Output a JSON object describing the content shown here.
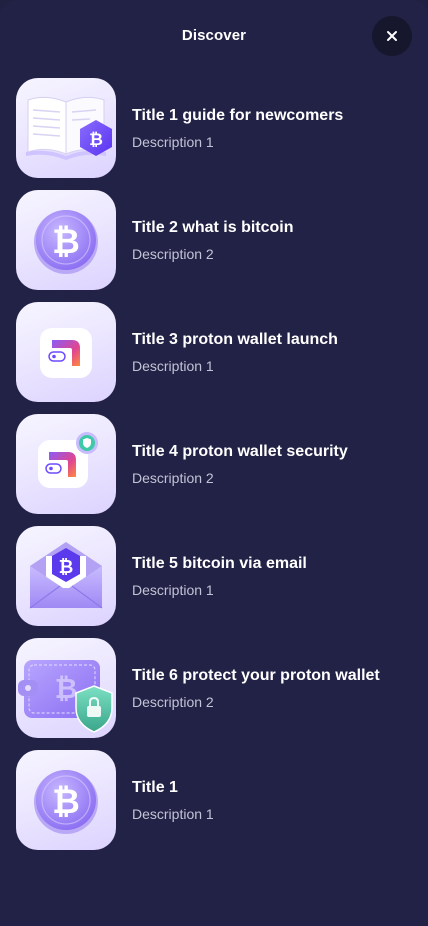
{
  "header": {
    "title": "Discover",
    "close_icon": "close-icon"
  },
  "articles": [
    {
      "title": "Title 1 guide for newcomers",
      "description": "Description 1",
      "icon": "book-bitcoin-icon"
    },
    {
      "title": "Title 2 what is bitcoin",
      "description": "Description 2",
      "icon": "bitcoin-coin-icon"
    },
    {
      "title": "Title 3 proton wallet launch",
      "description": "Description 1",
      "icon": "proton-wallet-icon"
    },
    {
      "title": "Title 4 proton wallet security",
      "description": "Description 2",
      "icon": "proton-wallet-shield-icon"
    },
    {
      "title": "Title 5 bitcoin via email",
      "description": "Description 1",
      "icon": "bitcoin-envelope-icon"
    },
    {
      "title": "Title 6 protect your proton wallet",
      "description": "Description 2",
      "icon": "wallet-shield-lock-icon"
    },
    {
      "title": "Title 1",
      "description": "Description 1",
      "icon": "bitcoin-coin-icon"
    }
  ],
  "colors": {
    "background": "#222246",
    "close_button": "#16162c",
    "accent": "#6d4aff",
    "description_text": "#c3c3d6"
  }
}
